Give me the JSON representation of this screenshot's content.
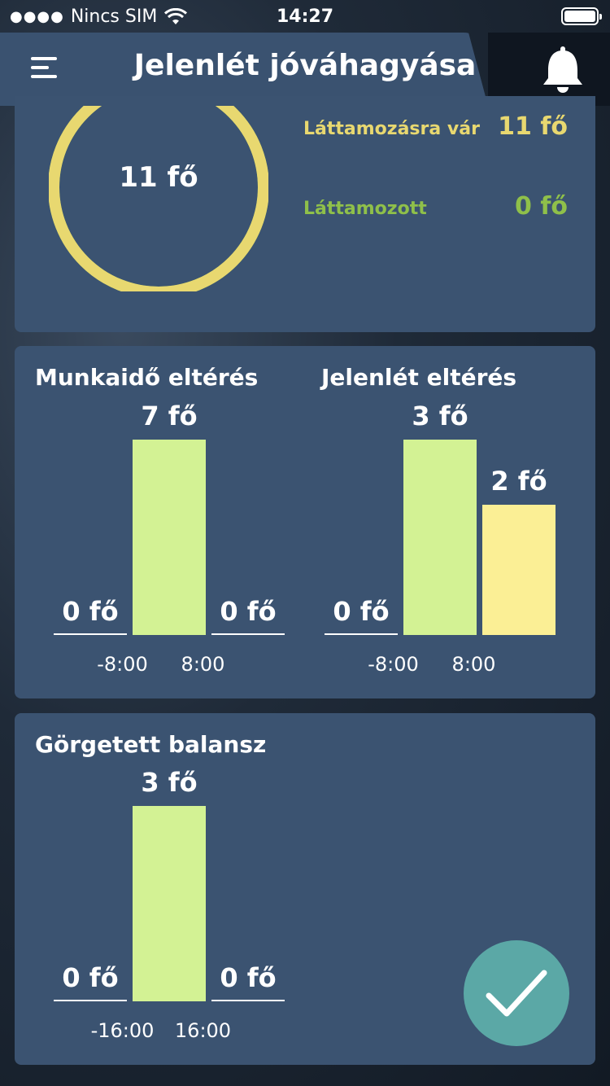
{
  "status": {
    "carrier": "Nincs SIM",
    "time": "14:27"
  },
  "header": {
    "title": "Jelenlét jóváhagyása",
    "menu_icon": "hamburger-menu-icon",
    "bell_icon": "bell-icon"
  },
  "summary": {
    "total": "11 fő",
    "pending_label": "Láttamozásra vár",
    "pending_value": "11 fő",
    "approved_label": "Láttamozott",
    "approved_value": "0 fő",
    "pending_fraction": 1.0,
    "colors": {
      "pending": "#e8d870",
      "approved": "#8fc04a"
    }
  },
  "chart_data": [
    {
      "type": "bar",
      "title": "Munkaidő eltérés",
      "categories": [
        "< -8:00",
        "-8:00 – 8:00",
        "> 8:00"
      ],
      "values": [
        0,
        7,
        0
      ],
      "labels": [
        "0 fő",
        "7 fő",
        "0 fő"
      ],
      "ticks": [
        "-8:00",
        "8:00"
      ],
      "colors": [
        "#d3f294",
        "#d3f294",
        "#d3f294"
      ]
    },
    {
      "type": "bar",
      "title": "Jelenlét eltérés",
      "categories": [
        "< -8:00",
        "-8:00 – 8:00",
        "> 8:00"
      ],
      "values": [
        0,
        3,
        2
      ],
      "labels": [
        "0 fő",
        "3 fő",
        "2 fő"
      ],
      "ticks": [
        "-8:00",
        "8:00"
      ],
      "colors": [
        "#d3f294",
        "#d3f294",
        "#fbef95"
      ]
    },
    {
      "type": "bar",
      "title": "Görgetett balansz",
      "categories": [
        "< -16:00",
        "-16:00 – 16:00",
        "> 16:00"
      ],
      "values": [
        0,
        3,
        0
      ],
      "labels": [
        "0 fő",
        "3 fő",
        "0 fő"
      ],
      "ticks": [
        "-16:00",
        "16:00"
      ],
      "colors": [
        "#d3f294",
        "#d3f294",
        "#d3f294"
      ]
    }
  ],
  "fab": {
    "icon": "checkmark-icon"
  }
}
